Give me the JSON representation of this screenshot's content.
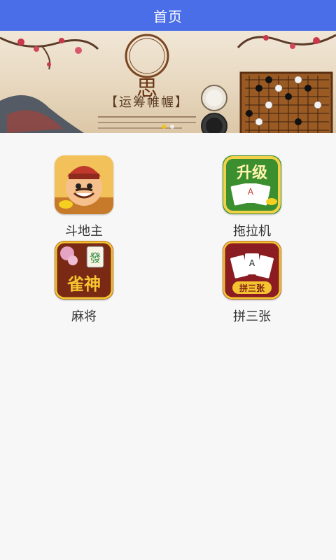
{
  "app_bar": {
    "title": "首页"
  },
  "banner": {
    "seal_character": "思",
    "slogan": "【运筹帷幄】",
    "slide_count": 2,
    "active_slide": 1
  },
  "games": [
    {
      "label": "斗地主",
      "icon": "doudizhu-icon",
      "icon_text": ""
    },
    {
      "label": "拖拉机",
      "icon": "tuolaji-icon",
      "icon_text": "升级"
    },
    {
      "label": "麻将",
      "icon": "mahjong-icon",
      "icon_text": "雀神"
    },
    {
      "label": "拼三张",
      "icon": "pinsanzhang-icon",
      "icon_text": "拼三张"
    }
  ],
  "colors": {
    "app_bar": "#4a6ee8",
    "background": "#f7f7f7"
  }
}
